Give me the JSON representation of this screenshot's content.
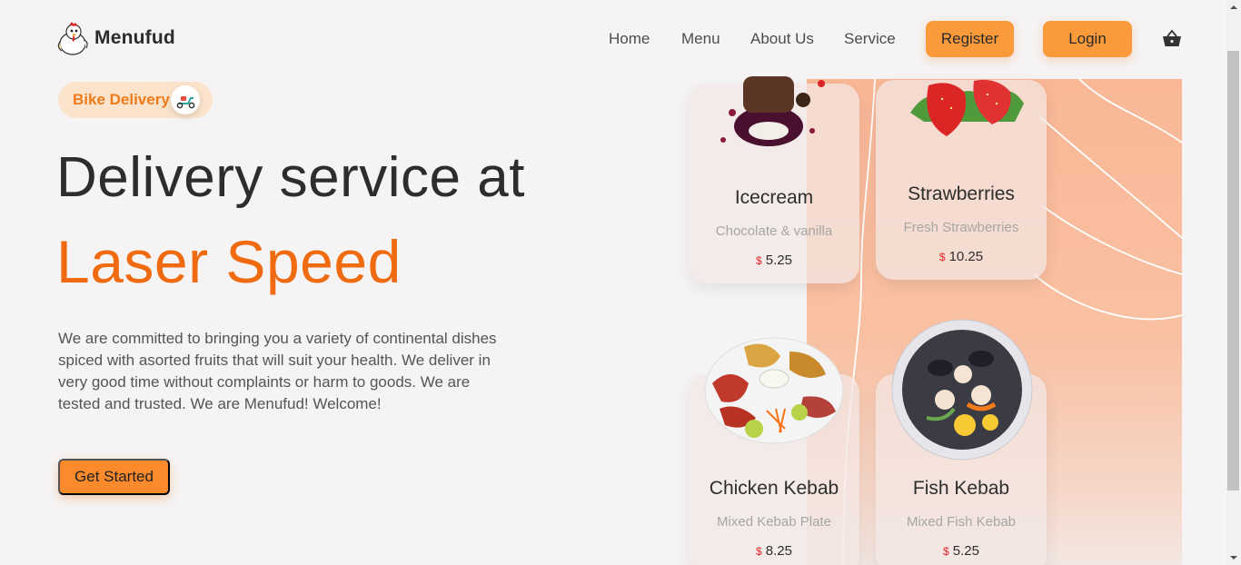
{
  "brand": {
    "name": "Menufud",
    "logo_icon": "chicken-mascot-icon"
  },
  "nav": {
    "links": [
      "Home",
      "Menu",
      "About Us",
      "Service"
    ],
    "register_label": "Register",
    "login_label": "Login",
    "cart_icon": "basket-icon"
  },
  "hero": {
    "badge_label": "Bike Delivery",
    "badge_icon": "scooter-icon",
    "headline_line1": "Delivery service at",
    "headline_line2": "Laser Speed",
    "description": "We are committed to bringing you a variety of continental dishes spiced with asorted fruits that will suit your health. We deliver in very good time without complaints or harm to goods. We are tested and trusted. We are Menufud! Welcome!",
    "cta_label": "Get Started"
  },
  "currency_symbol": "$",
  "menu_cards": [
    {
      "title": "Icecream",
      "subtitle": "Chocolate & vanilla",
      "price": "5.25",
      "image_icon": "icecream-icon"
    },
    {
      "title": "Strawberries",
      "subtitle": "Fresh Strawberries",
      "price": "10.25",
      "image_icon": "strawberry-icon"
    },
    {
      "title": "Chicken Kebab",
      "subtitle": "Mixed Kebab Plate",
      "price": "8.25",
      "image_icon": "chicken-kebab-plate-icon"
    },
    {
      "title": "Fish Kebab",
      "subtitle": "Mixed Fish Kebab",
      "price": "5.25",
      "image_icon": "fish-kebab-plate-icon"
    }
  ],
  "colors": {
    "accent": "#f06a10",
    "button": "#fb9a3a",
    "panel": "#f9b796",
    "price_symbol": "#e4262a"
  }
}
